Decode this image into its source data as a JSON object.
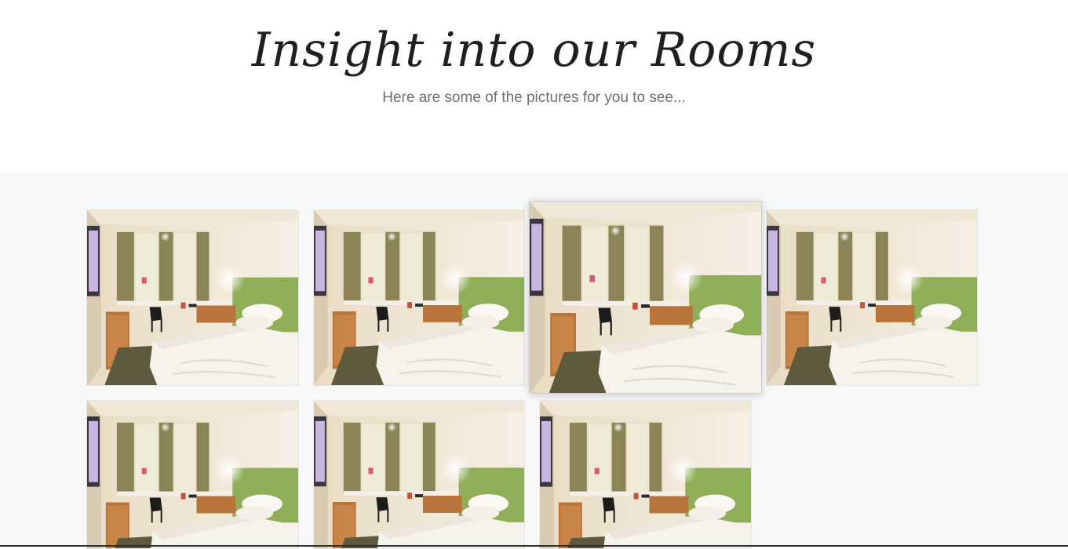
{
  "section": {
    "title": "Insight into our Rooms",
    "subtitle": "Here are some of the pictures for you to see..."
  },
  "gallery": {
    "photos": [
      {
        "alt": "hotel-room-photo"
      },
      {
        "alt": "hotel-room-photo"
      },
      {
        "alt": "hotel-room-photo",
        "state": "hovered"
      },
      {
        "alt": "hotel-room-photo"
      },
      {
        "alt": "hotel-room-photo"
      },
      {
        "alt": "hotel-room-photo"
      },
      {
        "alt": "hotel-room-photo"
      }
    ]
  },
  "colors": {
    "gallery_background": "#f7f8fa",
    "headboard_green": "#8fae58",
    "curtain_olive": "#8c8456"
  }
}
